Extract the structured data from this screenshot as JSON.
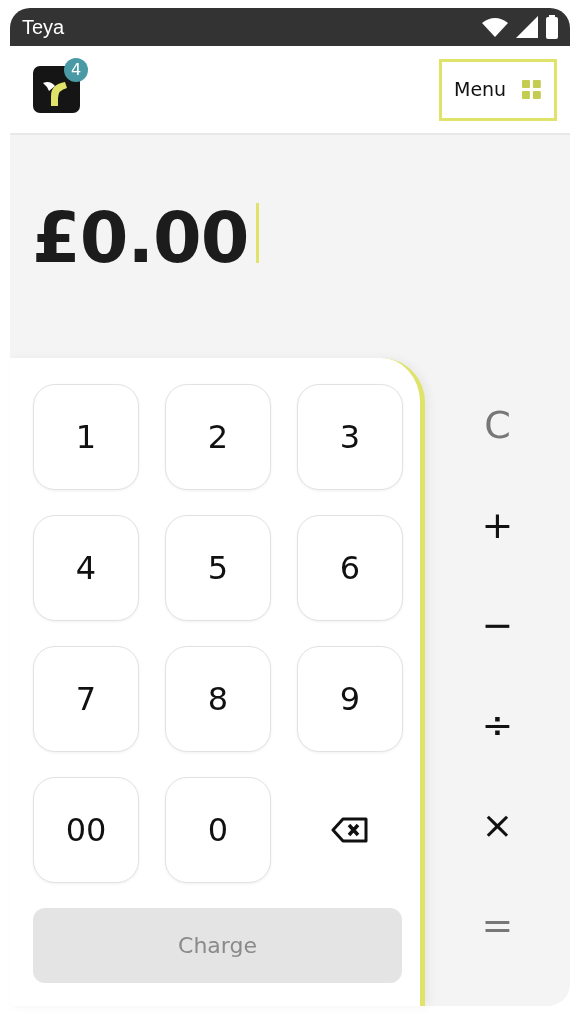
{
  "status_bar": {
    "title": "Teya"
  },
  "header": {
    "notification_count": "4",
    "menu": {
      "label": "Menu",
      "focused": true
    }
  },
  "amount": {
    "value": "£0.00",
    "cursor": true
  },
  "keypad": [
    {
      "kind": "digit",
      "label": "1"
    },
    {
      "kind": "digit",
      "label": "2"
    },
    {
      "kind": "digit",
      "label": "3"
    },
    {
      "kind": "digit",
      "label": "4"
    },
    {
      "kind": "digit",
      "label": "5"
    },
    {
      "kind": "digit",
      "label": "6"
    },
    {
      "kind": "digit",
      "label": "7"
    },
    {
      "kind": "digit",
      "label": "8"
    },
    {
      "kind": "digit",
      "label": "9"
    },
    {
      "kind": "digit",
      "label": "00"
    },
    {
      "kind": "digit",
      "label": "0"
    },
    {
      "kind": "backspace"
    }
  ],
  "charge_button": {
    "label": "Charge",
    "disabled": true
  },
  "operators": [
    {
      "label": "C",
      "disabled": true
    },
    {
      "label": "+",
      "disabled": false
    },
    {
      "label": "−",
      "disabled": false
    },
    {
      "label": "÷",
      "disabled": false
    },
    {
      "label": "×",
      "disabled": false
    },
    {
      "label": "=",
      "disabled": true
    }
  ]
}
